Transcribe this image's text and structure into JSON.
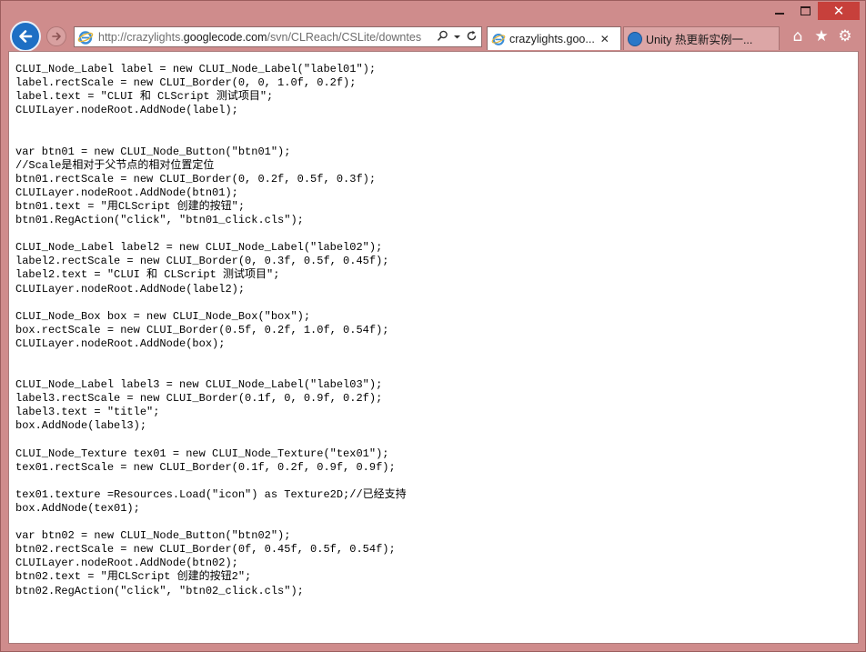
{
  "browser": {
    "address": {
      "prefix": "http://crazylights.",
      "domain": "googlecode.com",
      "suffix": "/svn/CLReach/CSLite/downtes"
    },
    "tabs": [
      {
        "label": "crazylights.goo...",
        "active": true
      },
      {
        "label": "Unity 热更新实例一...",
        "active": false
      }
    ],
    "icons": [
      "back-arrow-icon",
      "forward-arrow-icon",
      "search-icon",
      "dropdown-icon",
      "refresh-icon",
      "home-icon",
      "favorites-star-icon",
      "settings-gear-icon"
    ],
    "accent_color": "#1e6fc4",
    "frame_color": "#cf8c8c"
  },
  "code_lines": [
    "CLUI_Node_Label label = new CLUI_Node_Label(\"label01\");",
    "label.rectScale = new CLUI_Border(0, 0, 1.0f, 0.2f);",
    "label.text = \"CLUI 和 CLScript 测试项目\";",
    "CLUILayer.nodeRoot.AddNode(label);",
    "",
    "",
    "var btn01 = new CLUI_Node_Button(\"btn01\");",
    "//Scale是相对于父节点的相对位置定位",
    "btn01.rectScale = new CLUI_Border(0, 0.2f, 0.5f, 0.3f);",
    "CLUILayer.nodeRoot.AddNode(btn01);",
    "btn01.text = \"用CLScript 创建的按钮\";",
    "btn01.RegAction(\"click\", \"btn01_click.cls\");",
    "",
    "CLUI_Node_Label label2 = new CLUI_Node_Label(\"label02\");",
    "label2.rectScale = new CLUI_Border(0, 0.3f, 0.5f, 0.45f);",
    "label2.text = \"CLUI 和 CLScript 测试项目\";",
    "CLUILayer.nodeRoot.AddNode(label2);",
    "",
    "CLUI_Node_Box box = new CLUI_Node_Box(\"box\");",
    "box.rectScale = new CLUI_Border(0.5f, 0.2f, 1.0f, 0.54f);",
    "CLUILayer.nodeRoot.AddNode(box);",
    "",
    "",
    "CLUI_Node_Label label3 = new CLUI_Node_Label(\"label03\");",
    "label3.rectScale = new CLUI_Border(0.1f, 0, 0.9f, 0.2f);",
    "label3.text = \"title\";",
    "box.AddNode(label3);",
    "",
    "CLUI_Node_Texture tex01 = new CLUI_Node_Texture(\"tex01\");",
    "tex01.rectScale = new CLUI_Border(0.1f, 0.2f, 0.9f, 0.9f);",
    "",
    "tex01.texture =Resources.Load(\"icon\") as Texture2D;//已经支持",
    "box.AddNode(tex01);",
    "",
    "var btn02 = new CLUI_Node_Button(\"btn02\");",
    "btn02.rectScale = new CLUI_Border(0f, 0.45f, 0.5f, 0.54f);",
    "CLUILayer.nodeRoot.AddNode(btn02);",
    "btn02.text = \"用CLScript 创建的按钮2\";",
    "btn02.RegAction(\"click\", \"btn02_click.cls\");"
  ]
}
